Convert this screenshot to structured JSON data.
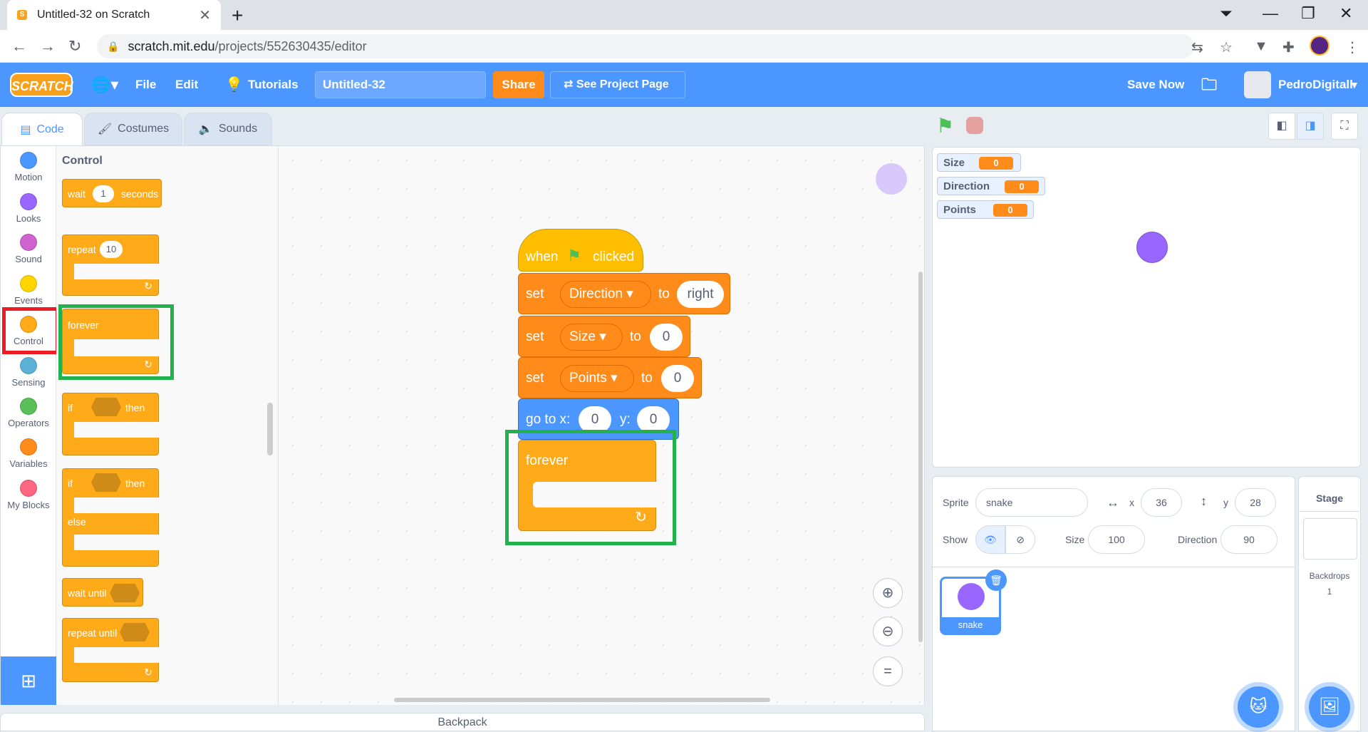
{
  "browser": {
    "tab_title": "Untitled-32 on Scratch",
    "url_host": "scratch.mit.edu",
    "url_path": "/projects/552630435/editor"
  },
  "menu": {
    "logo": "SCRATCH",
    "file": "File",
    "edit": "Edit",
    "tutorials": "Tutorials",
    "project_title": "Untitled-32",
    "share": "Share",
    "see_project_page": "See Project Page",
    "save_now": "Save Now",
    "username": "PedroDigitall"
  },
  "tabs": {
    "code": "Code",
    "costumes": "Costumes",
    "sounds": "Sounds"
  },
  "categories": [
    {
      "label": "Motion",
      "color": "#4c97ff"
    },
    {
      "label": "Looks",
      "color": "#9966ff"
    },
    {
      "label": "Sound",
      "color": "#cf63cf"
    },
    {
      "label": "Events",
      "color": "#ffd500"
    },
    {
      "label": "Control",
      "color": "#ffab19"
    },
    {
      "label": "Sensing",
      "color": "#5cb1d6"
    },
    {
      "label": "Operators",
      "color": "#59c059"
    },
    {
      "label": "Variables",
      "color": "#ff8c1a"
    },
    {
      "label": "My Blocks",
      "color": "#ff6680"
    }
  ],
  "palette": {
    "title": "Control",
    "wait": "wait",
    "wait_value": "1",
    "seconds": "seconds",
    "repeat": "repeat",
    "repeat_value": "10",
    "forever": "forever",
    "if1": "if",
    "then1": "then",
    "if2": "if",
    "then2": "then",
    "else": "else",
    "wait_until": "wait until",
    "repeat_until": "repeat until"
  },
  "script": {
    "when": "when",
    "clicked": "clicked",
    "set1": "set",
    "set1_var": "Direction",
    "to1": "to",
    "set1_val": "right",
    "set2": "set",
    "set2_var": "Size",
    "to2": "to",
    "set2_val": "0",
    "set3": "set",
    "set3_var": "Points",
    "to3": "to",
    "set3_val": "0",
    "goto": "go to x:",
    "x_val": "0",
    "y_label": "y:",
    "y_val": "0",
    "forever": "forever"
  },
  "backpack": "Backpack",
  "monitors": [
    {
      "name": "Size",
      "value": "0"
    },
    {
      "name": "Direction",
      "value": "0"
    },
    {
      "name": "Points",
      "value": "0"
    }
  ],
  "sprite_info": {
    "sprite_label": "Sprite",
    "sprite_name": "snake",
    "x_label": "x",
    "x": "36",
    "y_label": "y",
    "y": "28",
    "show_label": "Show",
    "size_label": "Size",
    "size": "100",
    "direction_label": "Direction",
    "direction": "90"
  },
  "sprite_tile": {
    "name": "snake"
  },
  "stage_panel": {
    "title": "Stage",
    "backdrops_label": "Backdrops",
    "backdrops_count": "1"
  },
  "colors": {
    "accent": "#4c97ff",
    "control": "#ffab19",
    "variables": "#ff8c1a",
    "motion": "#4c97ff",
    "sprite": "#9966ff",
    "highlight_green": "#22b14c",
    "highlight_red": "#ed1c24"
  }
}
